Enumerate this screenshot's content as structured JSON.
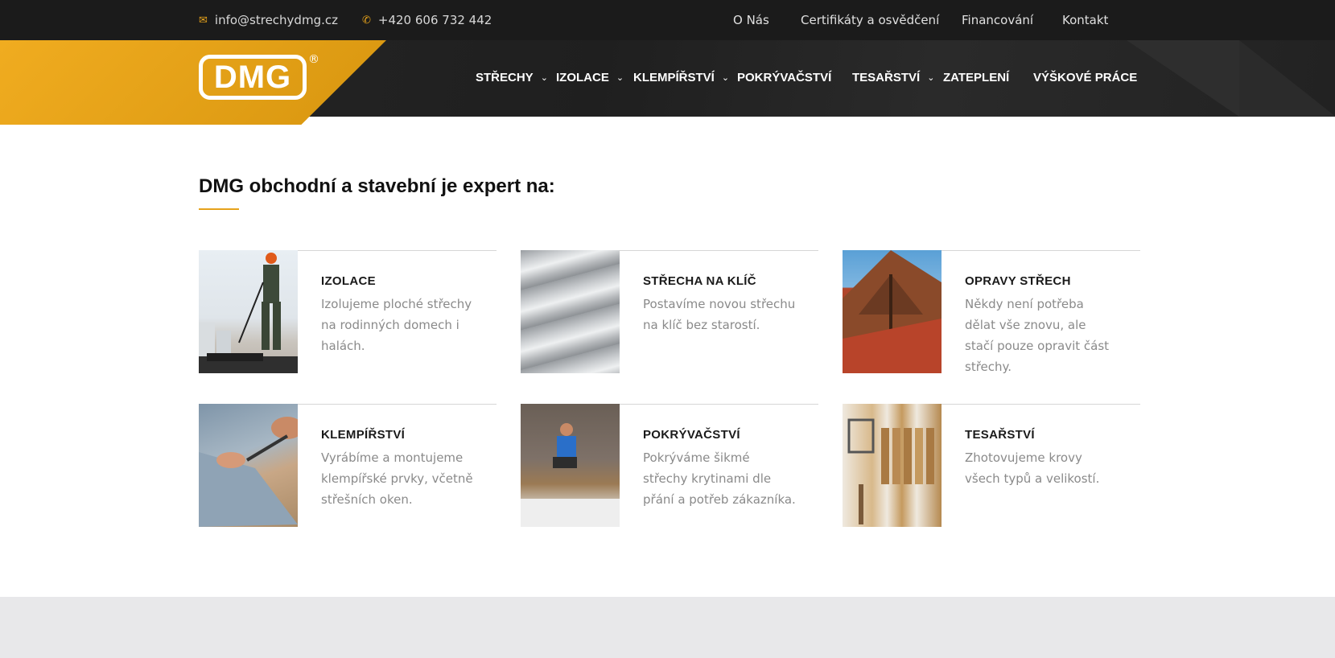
{
  "topbar": {
    "email": "info@strechydmg.cz",
    "phone": "+420 606 732 442",
    "email_icon": "envelope-icon",
    "phone_icon": "phone-icon",
    "links": [
      "O Nás",
      "Certifikáty a osvědčení",
      "Financování",
      "Kontakt"
    ]
  },
  "logo": {
    "text": "DMG",
    "mark": "®"
  },
  "nav": {
    "items": [
      {
        "label": "STŘECHY",
        "has_dropdown": true
      },
      {
        "label": "IZOLACE",
        "has_dropdown": true
      },
      {
        "label": "KLEMPÍŘSTVÍ",
        "has_dropdown": true
      },
      {
        "label": "POKRÝVAČSTVÍ",
        "has_dropdown": false
      },
      {
        "label": "TESAŘSTVÍ",
        "has_dropdown": true
      },
      {
        "label": "ZATEPLENÍ",
        "has_dropdown": false
      },
      {
        "label": "VÝŠKOVÉ PRÁCE",
        "has_dropdown": false
      }
    ],
    "dropdown_icon": "chevron-down-icon"
  },
  "main": {
    "heading": "DMG obchodní a stavební je expert na:",
    "services": [
      {
        "title": "IZOLACE",
        "desc": "Izolujeme ploché střechy na rodinných domech i halách."
      },
      {
        "title": "STŘECHA NA KLÍČ",
        "desc": "Postavíme novou střechu na klíč bez starostí."
      },
      {
        "title": "OPRAVY STŘECH",
        "desc": "Někdy není potřeba dělat vše znovu, ale stačí pouze opravit část střechy."
      },
      {
        "title": "KLEMPÍŘSTVÍ",
        "desc": "Vyrábíme a montujeme klempířské prvky, včetně střešních oken."
      },
      {
        "title": "POKRÝVAČSTVÍ",
        "desc": "Pokrýváme šikmé střechy krytinami dle přání a potřeb zákazníka."
      },
      {
        "title": "TESAŘSTVÍ",
        "desc": "Zhotovujeme krovy všech typů a velikostí."
      }
    ]
  },
  "colors": {
    "accent": "#e6a21b",
    "topbar_bg": "#1b1b1b",
    "header_bg": "#222222",
    "footer_band": "#e8e8ea"
  }
}
